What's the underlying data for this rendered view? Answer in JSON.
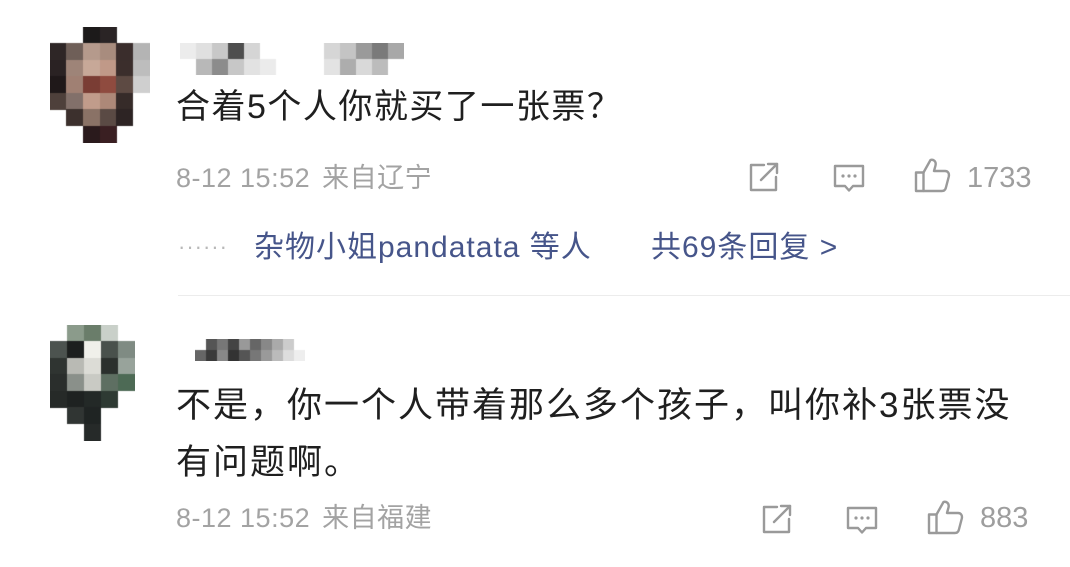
{
  "comments": [
    {
      "text": "合着5个人你就买了一张票？",
      "time": "8-12 15:52",
      "location": "来自辽宁",
      "like_count": "1733",
      "replies": {
        "dots": "······",
        "names": "杂物小姐pandatata 等人",
        "count_label": "共69条回复 >"
      }
    },
    {
      "text": "不是，你一个人带着那么多个孩子，叫你补3张票没有问题啊。",
      "time": "8-12 15:52",
      "location": "来自福建",
      "like_count": "883"
    }
  ],
  "icons": {
    "share": "share-icon",
    "reply": "comment-icon",
    "like": "thumbs-up-icon"
  },
  "colors": {
    "text": "#1f1f1f",
    "meta": "#a3a3a3",
    "link": "#46558a",
    "icon": "#9a9a9a",
    "divider": "#ececec"
  }
}
